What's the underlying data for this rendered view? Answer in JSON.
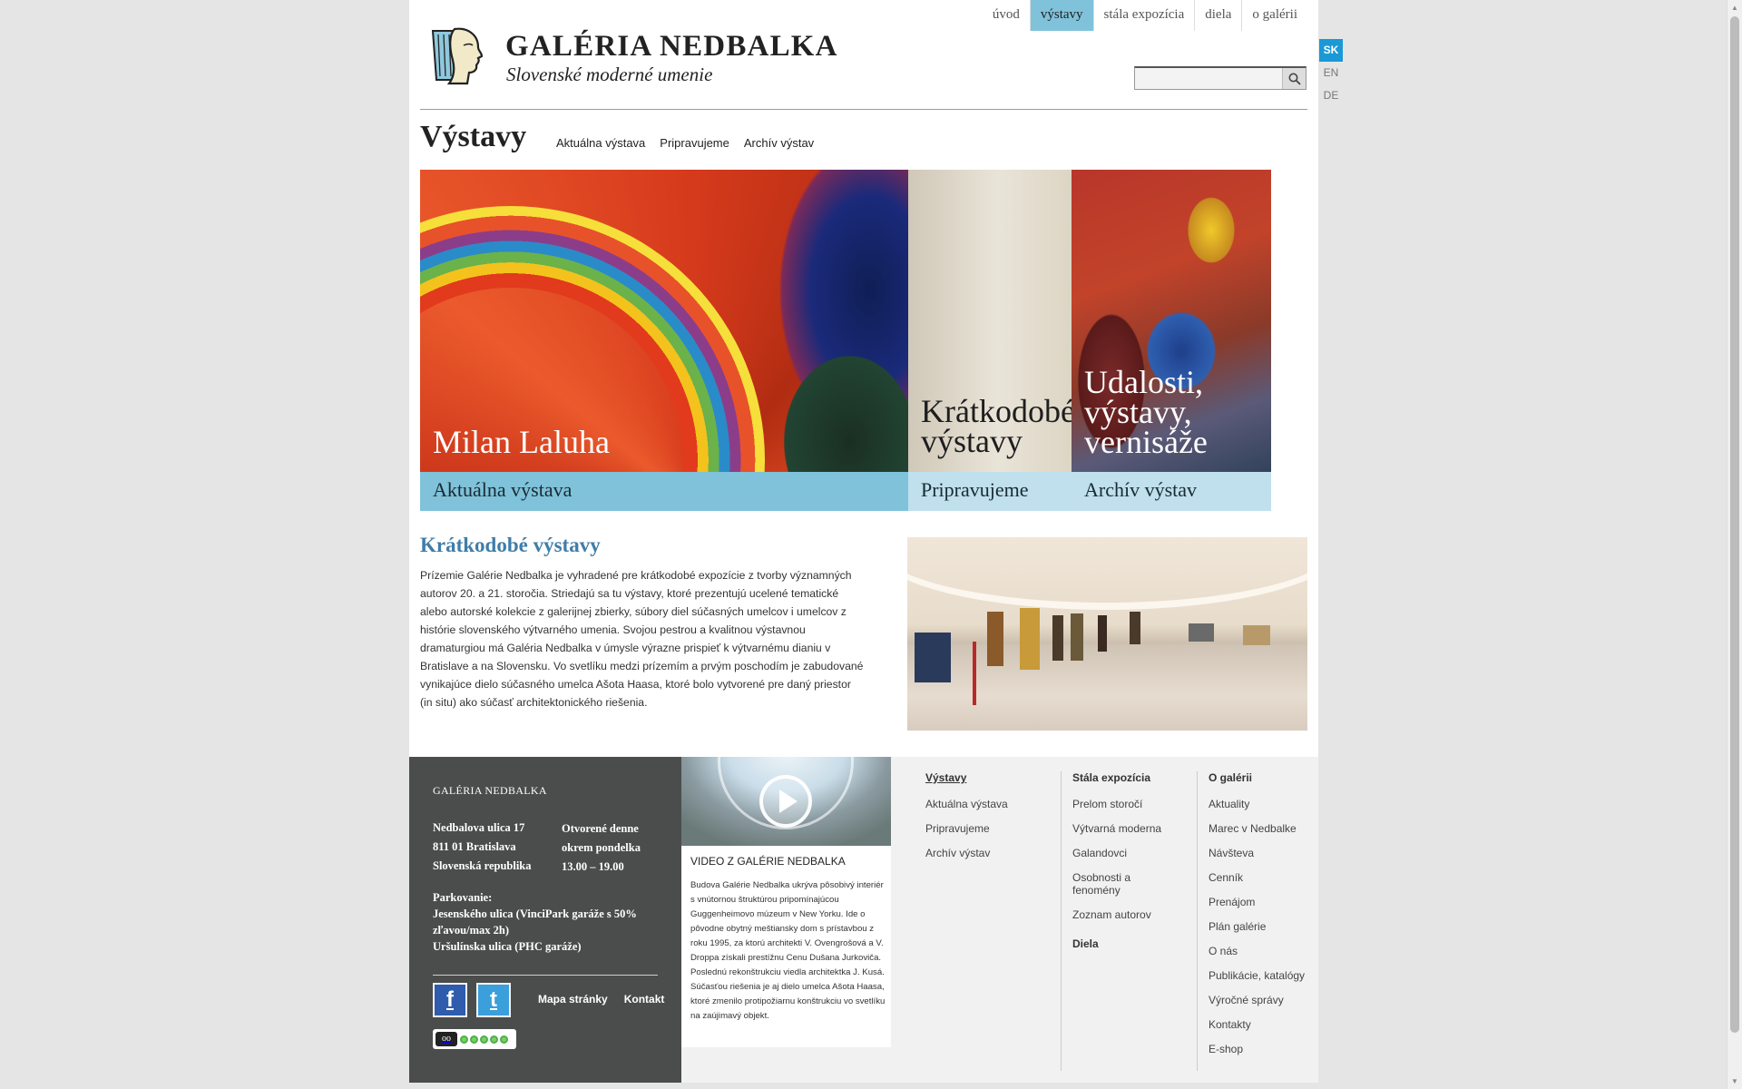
{
  "top_nav": [
    "úvod",
    "výstavy",
    "stála expozícia",
    "diela",
    "o galérii"
  ],
  "top_nav_active": "výstavy",
  "languages": [
    "SK",
    "EN",
    "DE"
  ],
  "language_active": "SK",
  "header": {
    "brand": "GALÉRIA NEDBALKA",
    "tagline": "Slovenské moderné umenie",
    "search_icon": "search-icon"
  },
  "section": {
    "title": "Výstavy",
    "subnav": [
      "Aktuálna výstava",
      "Pripravujeme",
      "Archív výstav"
    ]
  },
  "hero": [
    {
      "title": "Milan Laluha",
      "bar": "Aktuálna výstava"
    },
    {
      "title": "Krátkodobé výstavy",
      "bar": "Pripravujeme"
    },
    {
      "title": "Udalosti, výstavy, vernisáže",
      "bar": "Archív výstav"
    }
  ],
  "content": {
    "title": "Krátkodobé výstavy",
    "body": "Prízemie Galérie Nedbalka je vyhradené pre krátkodobé expozície z tvorby významných autorov 20. a 21. storočia. Striedajú sa tu výstavy, ktoré prezentujú ucelené tematické alebo autorské kolekcie z galerijnej zbierky, súbory diel súčasných umelcov i umelcov z histórie slovenského výtvarného umenia. Svojou pestrou a kvalitnou výstavnou dramaturgiou má Galéria Nedbalka v úmysle výrazne prispieť k výtvarnému dianiu v Bratislave a na Slovensku. Vo svetlíku medzi prízemím a prvým poschodím je zabudované vynikajúce dielo súčasného umelca Ašota Haasa, ktoré bolo vytvorené pre daný priestor (in situ) ako súčasť architektonického riešenia."
  },
  "footer": {
    "gallery_name": "GALÉRIA NEDBALKA",
    "address": "Nedbalova ulica 17\n811 01 Bratislava\nSlovenská republika",
    "opening": "Otvorené denne\nokrem pondelka\n13.00 – 19.00",
    "parking": "Parkovanie:\nJesenského ulica (VinciPark garáže s 50% zľavou/max 2h)\nUršulínska ulica (PHC garáže)",
    "social": [
      "f",
      "t"
    ],
    "links": [
      "Mapa stránky",
      "Kontakt"
    ],
    "video_title": "VIDEO Z GALÉRIE NEDBALKA",
    "video_desc": "Budova Galérie Nedbalka ukrýva pôsobivý interiér s vnútornou štruktúrou pripomínajúcou Guggenheimovo múzeum v New Yorku. Ide o pôvodne obytný meštiansky dom s prístavbou z roku 1995, za ktorú architekti V. Ovengrošová a V. Droppa získali prestížnu Cenu Dušana Jurkoviča. Poslednú rekonštrukciu viedla architektka J. Kusá. Súčasťou riešenia je aj dielo umelca Ašota Haasa, ktoré zmenilo protipožiarnu konštrukciu vo svetlíku na zaújimavý objekt.",
    "col1": {
      "heading": "Výstavy",
      "items": [
        "Aktuálna výstava",
        "Pripravujeme",
        "Archív výstav"
      ]
    },
    "col2": {
      "heading": "Stála expozícia",
      "items": [
        "Prelom storočí",
        "Výtvarná moderna",
        "Galandovci",
        "Osobnosti a fenomény",
        "Zoznam autorov"
      ],
      "heading2": "Diela"
    },
    "col3": {
      "heading": "O galérii",
      "items": [
        "Aktuality",
        "Marec v Nedbalke",
        "Návšteva",
        "Cenník",
        "Prenájom",
        "Plán galérie",
        "O nás",
        "Publikácie, katalógy",
        "Výročné správy",
        "Kontakty",
        "E-shop"
      ]
    }
  },
  "colors": {
    "accent": "#7fc2da",
    "accent_light": "#bfe0ec",
    "link_blue": "#3f7da8",
    "footer_dark": "#4b4d4d",
    "lang_active": "#1a99d6"
  }
}
